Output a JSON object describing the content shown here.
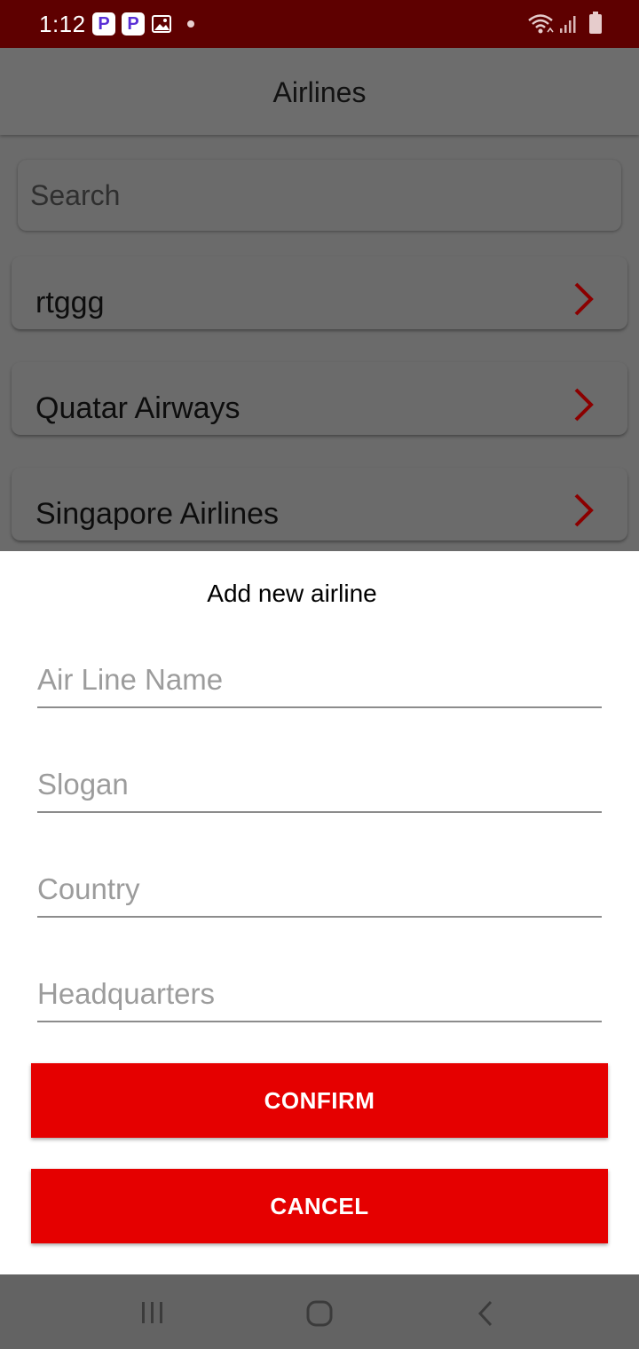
{
  "status_bar": {
    "time": "1:12",
    "badge_1": "P",
    "badge_2": "P",
    "icons": [
      "p-app-icon",
      "p-app-icon",
      "gallery-icon",
      "dot-icon",
      "wifi-icon",
      "signal-icon",
      "battery-icon"
    ]
  },
  "app_bar": {
    "title": "Airlines"
  },
  "search": {
    "placeholder": "Search",
    "value": ""
  },
  "airlines": [
    {
      "name": "rtggg"
    },
    {
      "name": "Quatar Airways"
    },
    {
      "name": "Singapore Airlines"
    }
  ],
  "dialog": {
    "title": "Add new airline",
    "fields": {
      "name_placeholder": "Air Line Name",
      "slogan_placeholder": "Slogan",
      "country_placeholder": "Country",
      "headquarters_placeholder": "Headquarters"
    },
    "confirm_label": "CONFIRM",
    "cancel_label": "CANCEL"
  },
  "colors": {
    "status_bar": "#5e0000",
    "accent": "#e50000",
    "chevron": "#8b0000",
    "scrim": "#6b6b6b"
  },
  "nav_bar": {
    "icons": [
      "recents-icon",
      "home-icon",
      "back-icon"
    ]
  }
}
